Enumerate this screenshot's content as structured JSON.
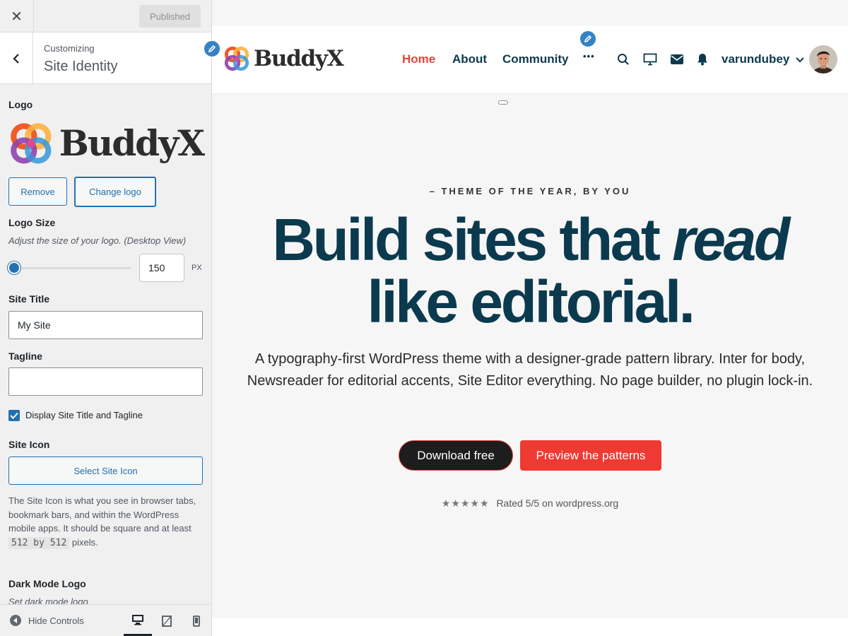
{
  "topbar": {
    "close_icon": "close-icon",
    "publish_label": "Published"
  },
  "section": {
    "customizing": "Customizing",
    "title": "Site Identity"
  },
  "logo": {
    "label": "Logo",
    "brand_text": "BuddyX",
    "remove_label": "Remove",
    "change_label": "Change logo"
  },
  "logo_size": {
    "label": "Logo Size",
    "description": "Adjust the size of your logo. (Desktop View)",
    "value": "150",
    "unit": "PX"
  },
  "site_title": {
    "label": "Site Title",
    "value": "My Site"
  },
  "tagline": {
    "label": "Tagline",
    "value": ""
  },
  "display_title": {
    "label": "Display Site Title and Tagline",
    "checked": true
  },
  "site_icon": {
    "label": "Site Icon",
    "button": "Select Site Icon",
    "help_1": "The Site Icon is what you see in browser tabs, bookmark bars, and within the WordPress mobile apps. It should be square and at least",
    "code": "512 by 512",
    "help_2": "pixels."
  },
  "dark_logo": {
    "label": "Dark Mode Logo",
    "description": "Set dark mode logo"
  },
  "footer": {
    "hide_controls": "Hide Controls"
  },
  "site": {
    "brand_text": "BuddyX",
    "nav": [
      "Home",
      "About",
      "Community"
    ],
    "more": "•••",
    "username": "varundubey",
    "eyebrow": "– THEME OF THE YEAR, BY YOU",
    "title_1": "Build sites that",
    "title_em": "read",
    "title_2": "like editorial.",
    "subtitle": "A typography-first WordPress theme with a designer-grade pattern library. Inter for body, Newsreader for editorial accents, Site Editor everything. No page builder, no plugin lock-in.",
    "cta_primary": "Download free",
    "cta_secondary": "Preview the patterns",
    "stars": "★★★★★",
    "rating": "Rated 5/5 on wordpress.org"
  },
  "colors": {
    "accent": "#2271b1",
    "brand_red": "#ee3a33",
    "heading": "#0b3a4e"
  }
}
